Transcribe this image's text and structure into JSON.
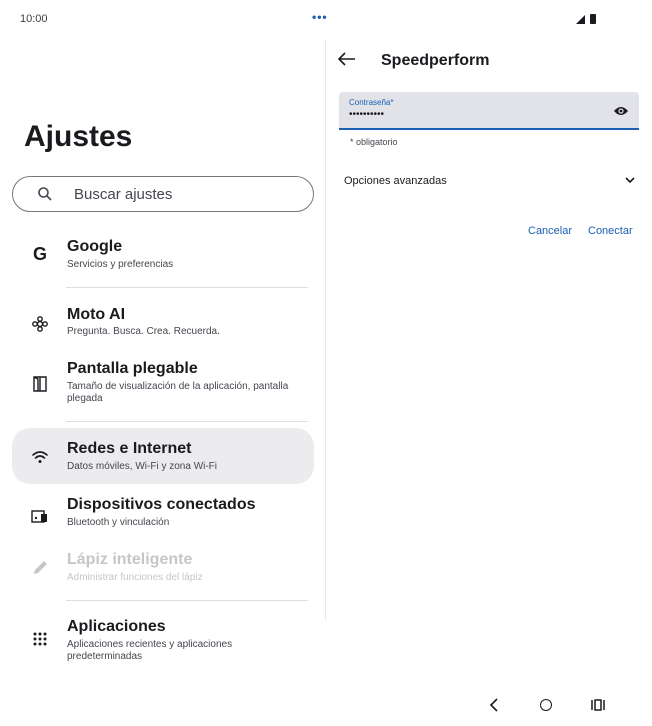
{
  "status": {
    "time": "10:00"
  },
  "settings": {
    "title": "Ajustes",
    "search_placeholder": "Buscar ajustes",
    "items": [
      {
        "title": "Google",
        "subtitle": "Servicios y preferencias",
        "icon": "google-icon"
      },
      {
        "title": "Moto AI",
        "subtitle": "Pregunta. Busca. Crea. Recuerda.",
        "icon": "moto-ai-icon"
      },
      {
        "title": "Pantalla plegable",
        "subtitle": "Tamaño de visualización de la aplicación, pantalla plegada",
        "icon": "foldable-icon"
      },
      {
        "title": "Redes e Internet",
        "subtitle": "Datos móviles, Wi-Fi y zona Wi-Fi",
        "icon": "wifi-icon",
        "selected": true
      },
      {
        "title": "Dispositivos conectados",
        "subtitle": "Bluetooth y vinculación",
        "icon": "devices-icon"
      },
      {
        "title": "Lápiz inteligente",
        "subtitle": "Administrar funciones del lápiz",
        "icon": "pen-icon",
        "disabled": true
      },
      {
        "title": "Aplicaciones",
        "subtitle": "Aplicaciones recientes y aplicaciones predeterminadas",
        "icon": "apps-grid-icon"
      }
    ]
  },
  "detail": {
    "title": "Speedperform",
    "password_label": "Contraseña*",
    "password_value": "••••••••••",
    "password_help": "* obligatorio",
    "advanced_label": "Opciones avanzadas",
    "cancel_label": "Cancelar",
    "connect_label": "Conectar"
  },
  "colors": {
    "accent": "#1a5fb4",
    "selected_bg": "#ececef",
    "field_bg": "#e2e3e9"
  }
}
